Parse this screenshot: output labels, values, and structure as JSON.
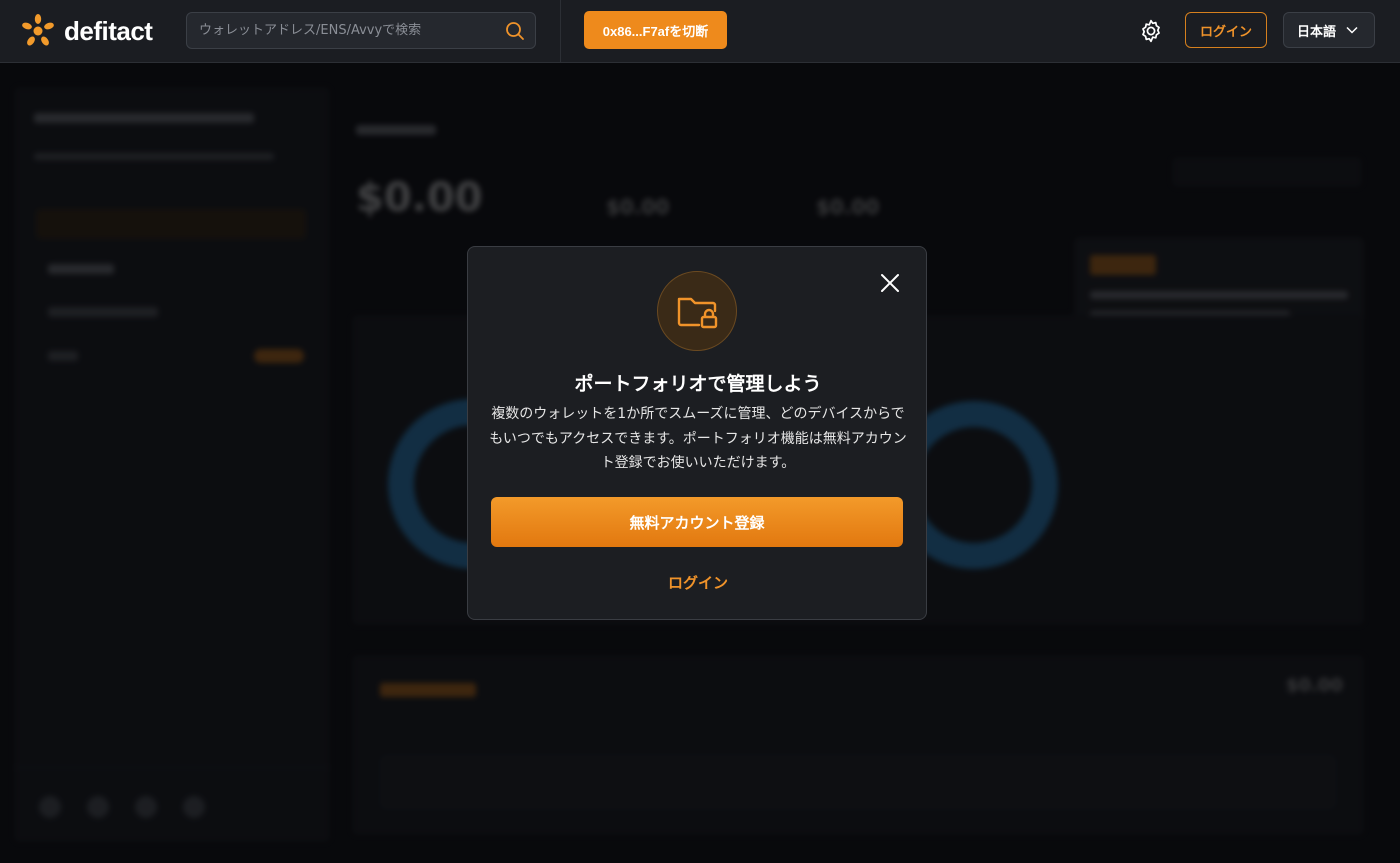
{
  "header": {
    "logo_text": "defitact",
    "search_placeholder": "ウォレットアドレス/ENS/Avvyで検索",
    "wallet_button": "0x86...F7afを切断",
    "login_label": "ログイン",
    "language_label": "日本語"
  },
  "background": {
    "total_value": "$0.00",
    "sub_value_1": "$0.00",
    "sub_value_2": "$0.00",
    "wallet_total": "$0.00"
  },
  "modal": {
    "title": "ポートフォリオで管理しよう",
    "description": "複数のウォレットを1か所でスムーズに管理、どのデバイスからでもいつでもアクセスできます。ポートフォリオ機能は無料アカウント登録でお使いいただけます。",
    "signup_button": "無料アカウント登録",
    "login_link": "ログイン"
  },
  "colors": {
    "accent": "#ee8a1c",
    "background": "#0b0c10",
    "modal_bg": "#1c1e22",
    "donut": "#2e8fd3"
  }
}
